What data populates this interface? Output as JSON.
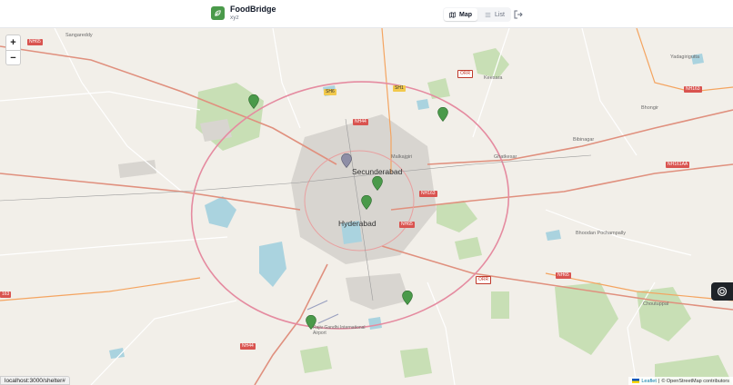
{
  "app": {
    "title": "FoodBridge",
    "subtitle": "xyz"
  },
  "view_toggle": {
    "map_label": "Map",
    "list_label": "List",
    "active": "Map"
  },
  "map": {
    "zoom_in": "+",
    "zoom_out": "−",
    "labels": {
      "secunderabad": "Secunderabad",
      "hyderabad": "Hyderabad",
      "sangareddy": "Sangareddy",
      "keesara": "Keesara",
      "bhongir": "Bhongir",
      "bibinagar": "Bibinagar",
      "ghatkesar": "Ghatkesar",
      "bhoodan": "Bhoodan Pochampally",
      "choutuppal": "Choutuppal",
      "yadagirigutta": "Yadagirigutta",
      "malkajgiri": "Malkajgiri",
      "airport": "Rajiv Gandhi International Airport"
    },
    "shields": {
      "nh65_w": "NH65",
      "nh44_n": "NH44",
      "sh6": "SH6",
      "sh1": "SH1",
      "orr_ne": "ORR",
      "nh163_e": "NH163",
      "nh163_c": "NH163",
      "nh161aa": "NH161AA",
      "nh65_c": "NH65",
      "nh65_se": "NH65",
      "orr_se": "ORR",
      "nh44_s": "NH44",
      "nh163_w": "163"
    },
    "attribution": {
      "leaflet": "Leaflet",
      "separator": "|",
      "osm": "© OpenStreetMap contributors"
    }
  },
  "status_bar": {
    "url": "localhost:3000/shelter#"
  },
  "colors": {
    "brand": "#4a9a4a",
    "marker": "#4a9a4a",
    "marker_selected": "#8e8ea6",
    "fab": "#1f2328"
  }
}
